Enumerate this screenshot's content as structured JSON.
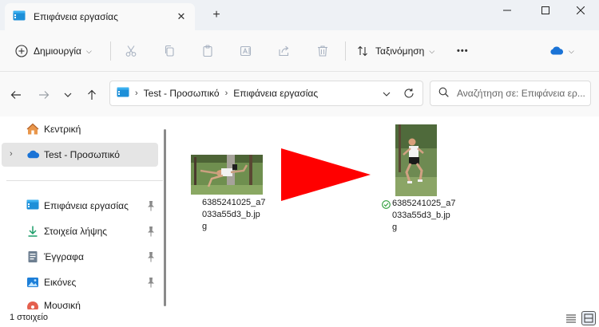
{
  "window": {
    "tab_title": "Επιφάνεια εργασίας",
    "new_tab_symbol": "+",
    "close_tab_symbol": "✕"
  },
  "toolbar": {
    "new_label": "Δημιουργία",
    "sort_label": "Ταξινόμηση",
    "more_symbol": "•••"
  },
  "address": {
    "crumbs": [
      "Test - Προσωπικό",
      "Επιφάνεια εργασίας"
    ]
  },
  "search": {
    "placeholder": "Αναζήτηση σε: Επιφάνεια ερ..."
  },
  "sidebar": {
    "items": [
      {
        "label": "Κεντρική",
        "icon": "home-icon"
      },
      {
        "label": "Test - Προσωπικό",
        "icon": "onedrive-cloud-icon"
      },
      {
        "label": "Επιφάνεια εργασίας",
        "icon": "desktop-icon",
        "pinned": true
      },
      {
        "label": "Στοιχεία λήψης",
        "icon": "download-icon",
        "pinned": true
      },
      {
        "label": "Έγγραφα",
        "icon": "documents-icon",
        "pinned": true
      },
      {
        "label": "Εικόνες",
        "icon": "pictures-icon",
        "pinned": true
      },
      {
        "label": "Μουσική",
        "icon": "music-icon",
        "pinned": true
      }
    ]
  },
  "files": [
    {
      "name_lines": [
        "6385241025_a7",
        "033a55d3_b.jp",
        "g"
      ]
    },
    {
      "name_lines": [
        "6385241025_a7",
        "033a55d3_b.jp",
        "g"
      ],
      "sync_status": "synced-check-icon"
    }
  ],
  "status": {
    "item_count": "1 στοιχείο"
  },
  "colors": {
    "accent": "#0067c0",
    "arrow": "#ff0000",
    "sync_green": "#2e9e3a"
  }
}
